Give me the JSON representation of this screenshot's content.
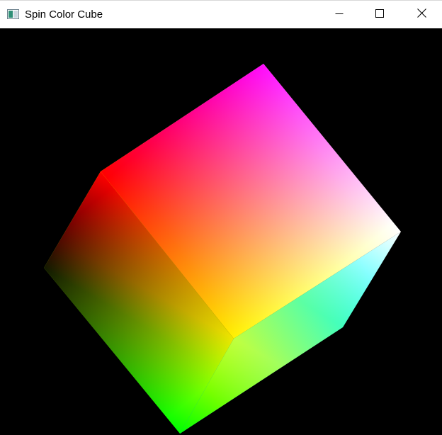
{
  "window": {
    "title": "Spin Color Cube",
    "background": "#000000"
  },
  "titlebar": {
    "app_icon": "app-window-icon",
    "controls": [
      {
        "name": "minimize",
        "icon": "minimize-icon"
      },
      {
        "name": "maximize",
        "icon": "maximize-icon"
      },
      {
        "name": "close",
        "icon": "close-icon"
      }
    ]
  },
  "scene": {
    "object": "rgb-color-cube",
    "vertex_colors": {
      "magenta": "#ff00ff",
      "red": "#ff0000",
      "black": "#000000",
      "green": "#00ff00",
      "cyan": "#00ffff",
      "white": "#ffffff",
      "yellow": "#ffff00"
    }
  }
}
